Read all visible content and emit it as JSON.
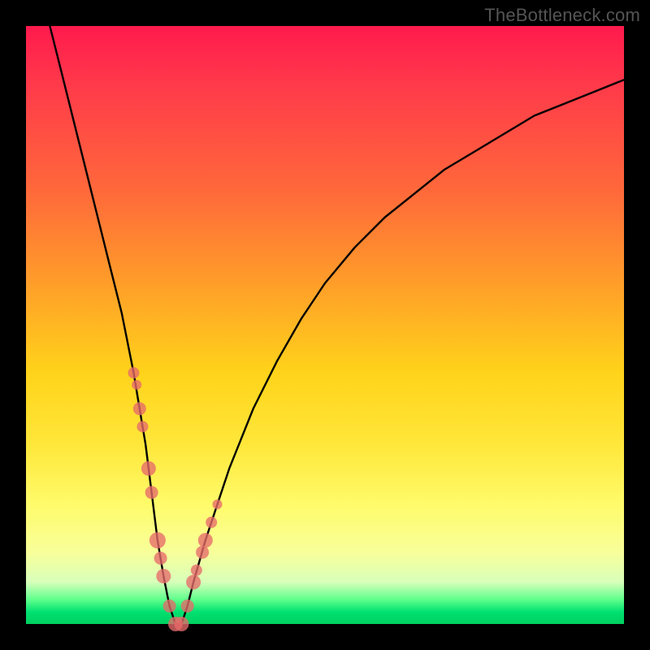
{
  "watermark": "TheBottleneck.com",
  "chart_data": {
    "type": "line",
    "title": "",
    "xlabel": "",
    "ylabel": "",
    "xlim": [
      0,
      100
    ],
    "ylim": [
      0,
      100
    ],
    "grid": false,
    "legend": false,
    "series": [
      {
        "name": "bottleneck-curve",
        "x": [
          4,
          6,
          8,
          10,
          12,
          14,
          16,
          18,
          19,
          20,
          21,
          22,
          23,
          24,
          25,
          26,
          27,
          28,
          30,
          32,
          34,
          38,
          42,
          46,
          50,
          55,
          60,
          65,
          70,
          75,
          80,
          85,
          90,
          95,
          100
        ],
        "y": [
          100,
          92,
          84,
          76,
          68,
          60,
          52,
          42,
          36,
          30,
          22,
          14,
          8,
          3,
          0,
          0,
          3,
          7,
          14,
          20,
          26,
          36,
          44,
          51,
          57,
          63,
          68,
          72,
          76,
          79,
          82,
          85,
          87,
          89,
          91
        ]
      }
    ],
    "points": {
      "name": "sample-dots",
      "x": [
        18.0,
        18.5,
        19.0,
        19.5,
        20.5,
        21.0,
        22.0,
        22.5,
        23.0,
        24.0,
        25.0,
        26.0,
        27.0,
        28.0,
        28.5,
        29.5,
        30.0,
        31.0,
        32.0
      ],
      "y": [
        42,
        40,
        36,
        33,
        26,
        22,
        14,
        11,
        8,
        3,
        0,
        0,
        3,
        7,
        9,
        12,
        14,
        17,
        20
      ],
      "r": [
        7,
        6,
        8,
        7,
        9,
        8,
        10,
        8,
        9,
        8,
        9,
        9,
        8,
        9,
        7,
        8,
        9,
        7,
        6
      ]
    },
    "background_gradient": {
      "top": "#ff1a4d",
      "mid": "#ffe73a",
      "bottom": "#00d060"
    }
  }
}
